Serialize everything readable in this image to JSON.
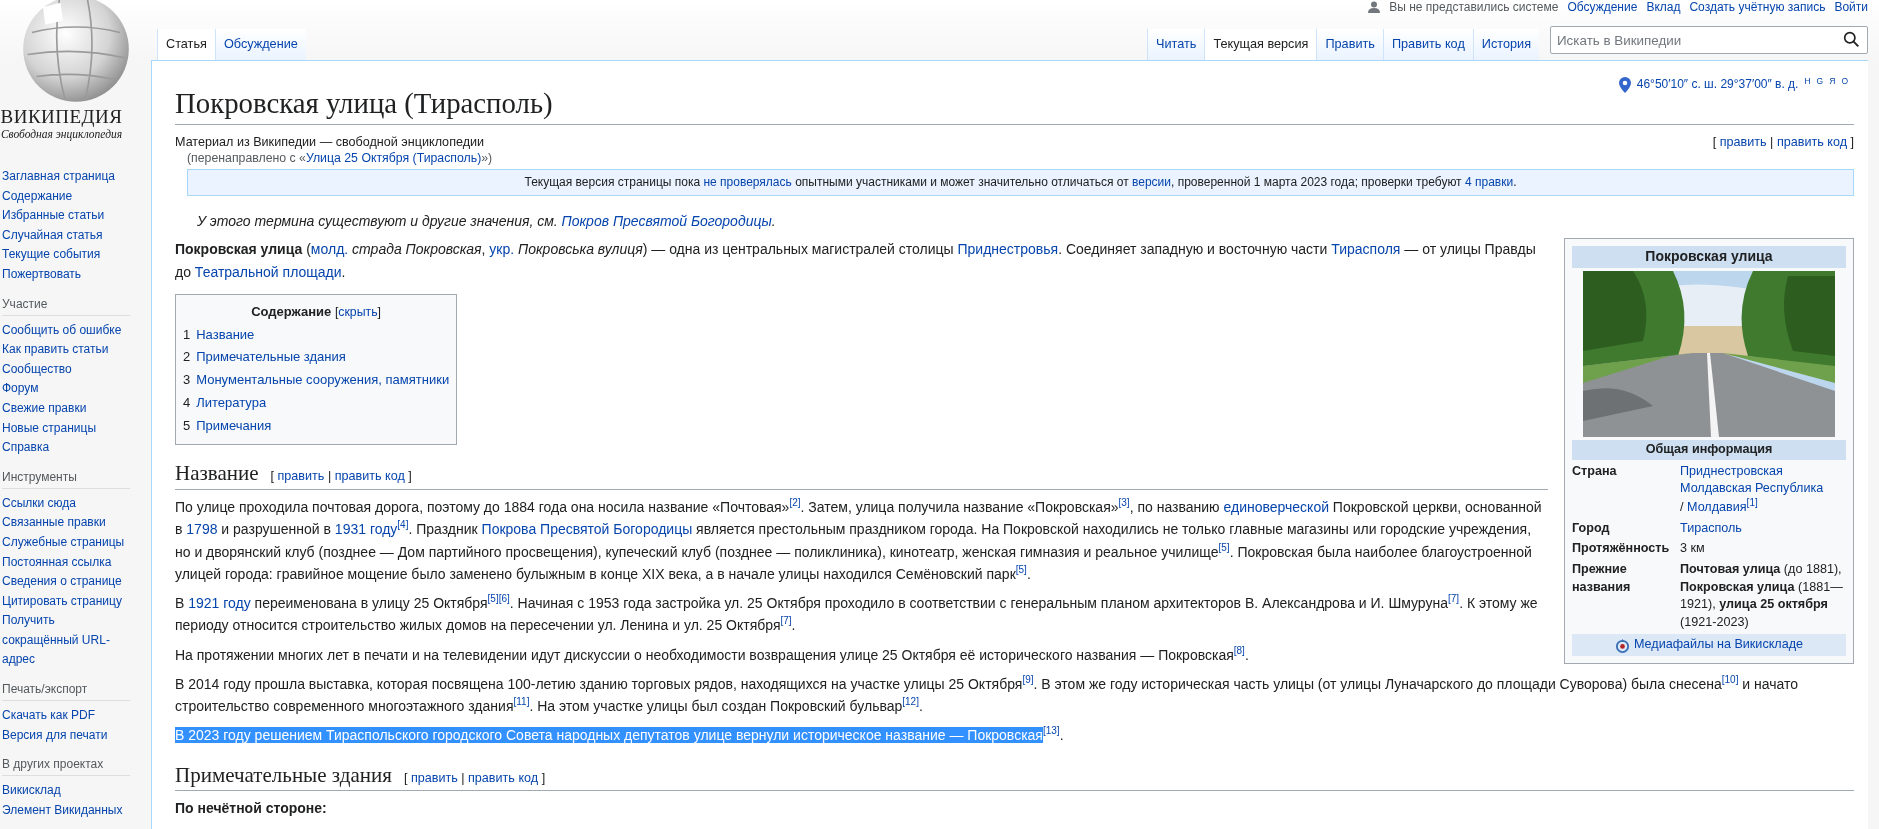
{
  "personal_tools": {
    "status": "Вы не представились системе",
    "links": [
      "Обсуждение",
      "Вклад",
      "Создать учётную запись",
      "Войти"
    ]
  },
  "logo": {
    "wordmark": "ВИКИПЕДИЯ",
    "tagline": "Свободная энциклопедия"
  },
  "sidebar": [
    {
      "items": [
        "Заглавная страница",
        "Содержание",
        "Избранные статьи",
        "Случайная статья",
        "Текущие события",
        "Пожертвовать"
      ]
    },
    {
      "heading": "Участие",
      "items": [
        "Сообщить об ошибке",
        "Как править статьи",
        "Сообщество",
        "Форум",
        "Свежие правки",
        "Новые страницы",
        "Справка"
      ]
    },
    {
      "heading": "Инструменты",
      "items": [
        "Ссылки сюда",
        "Связанные правки",
        "Служебные страницы",
        "Постоянная ссылка",
        "Сведения о странице",
        "Цитировать страницу",
        "Получить сокращённый URL-адрес"
      ]
    },
    {
      "heading": "Печать/экспорт",
      "items": [
        "Скачать как PDF",
        "Версия для печати"
      ]
    },
    {
      "heading": "В других проектах",
      "items": [
        "Викисклад",
        "Элемент Викиданных"
      ]
    }
  ],
  "namespaces": [
    {
      "label": "Статья",
      "selected": true
    },
    {
      "label": "Обсуждение",
      "selected": false
    }
  ],
  "views": [
    {
      "label": "Читать",
      "selected": false
    },
    {
      "label": "Текущая версия",
      "selected": true
    },
    {
      "label": "Править",
      "selected": false
    },
    {
      "label": "Править код",
      "selected": false
    },
    {
      "label": "История",
      "selected": false
    }
  ],
  "search": {
    "placeholder": "Искать в Википедии"
  },
  "article": {
    "title": "Покровская улица (Тирасполь)",
    "coordinates": {
      "text": "46°50′10″ с. ш. 29°37′00″ в. д.",
      "map_links": [
        "H",
        "G",
        "Я",
        "O"
      ]
    },
    "site_sub": "Материал из Википедии — свободной энциклопедии",
    "redirect": [
      {
        "kind": "plain",
        "text": "(перенаправлено с «"
      },
      {
        "kind": "link",
        "text": "Улица 25 Октября (Тирасполь)"
      },
      {
        "kind": "plain",
        "text": "»)"
      }
    ],
    "lead_edit": [
      {
        "kind": "plain",
        "text": "[ "
      },
      {
        "kind": "link",
        "text": "править"
      },
      {
        "kind": "plain",
        "text": " | "
      },
      {
        "kind": "link",
        "text": "править код"
      },
      {
        "kind": "plain",
        "text": " ]"
      }
    ],
    "notice": [
      {
        "kind": "plain",
        "text": "Текущая версия страницы пока "
      },
      {
        "kind": "link",
        "text": "не проверялась"
      },
      {
        "kind": "plain",
        "text": " опытными участниками и может значительно отличаться от "
      },
      {
        "kind": "link",
        "text": "версии"
      },
      {
        "kind": "plain",
        "text": ", проверенной 1 марта 2023 года; проверки требуют "
      },
      {
        "kind": "link",
        "text": "4 правки"
      },
      {
        "kind": "plain",
        "text": "."
      }
    ],
    "hatnote": [
      {
        "kind": "plain",
        "text": "У этого термина существуют и другие значения, см. "
      },
      {
        "kind": "link",
        "text": "Покров Пресвятой Богородицы"
      },
      {
        "kind": "plain",
        "text": "."
      }
    ],
    "intro": [
      {
        "kind": "bold",
        "text": "Покровская улица"
      },
      {
        "kind": "plain",
        "text": " ("
      },
      {
        "kind": "link",
        "text": "молд."
      },
      {
        "kind": "italic",
        "text": " страда Покровская"
      },
      {
        "kind": "plain",
        "text": ", "
      },
      {
        "kind": "link",
        "text": "укр."
      },
      {
        "kind": "italic",
        "text": " Покровська вулиця"
      },
      {
        "kind": "plain",
        "text": ") — одна из центральных магистралей столицы "
      },
      {
        "kind": "link",
        "text": "Приднестровья"
      },
      {
        "kind": "plain",
        "text": ". Соединяет западную и восточную части "
      },
      {
        "kind": "link",
        "text": "Тирасполя"
      },
      {
        "kind": "plain",
        "text": " — от улицы Правды до "
      },
      {
        "kind": "link",
        "text": "Театральной площади"
      },
      {
        "kind": "plain",
        "text": "."
      }
    ],
    "infobox": {
      "title": "Покровская улица",
      "subheader": "Общая информация",
      "rows": [
        {
          "label": "Страна",
          "value": [
            {
              "kind": "blocklink",
              "text": "Приднестровская Молдавская Республика"
            },
            {
              "kind": "plain",
              "text": " / "
            },
            {
              "kind": "link",
              "text": "Молдавия"
            },
            {
              "kind": "ref",
              "text": "[1]"
            }
          ]
        },
        {
          "label": "Город",
          "value": [
            {
              "kind": "link",
              "text": "Тирасполь"
            }
          ]
        },
        {
          "label": "Протяжённость",
          "value": [
            {
              "kind": "plain",
              "text": "3 км"
            }
          ]
        },
        {
          "label": "Прежние названия",
          "value": [
            {
              "kind": "bold",
              "text": "Почтовая улица"
            },
            {
              "kind": "plain",
              "text": " (до 1881), "
            },
            {
              "kind": "bold",
              "text": "Покровская улица"
            },
            {
              "kind": "plain",
              "text": " (1881—1921), "
            },
            {
              "kind": "bold",
              "text": "улица 25 октября"
            },
            {
              "kind": "plain",
              "text": " (1921-2023)"
            }
          ]
        }
      ],
      "commons": "Медиафайлы на Викискладе"
    },
    "toc": {
      "title": "Содержание",
      "toggle": [
        {
          "kind": "plain",
          "text": "["
        },
        {
          "kind": "link",
          "text": "скрыть"
        },
        {
          "kind": "plain",
          "text": "]"
        }
      ],
      "items": [
        {
          "number": "1",
          "label": "Название"
        },
        {
          "number": "2",
          "label": "Примечательные здания"
        },
        {
          "number": "3",
          "label": "Монументальные сооружения, памятники"
        },
        {
          "number": "4",
          "label": "Литература"
        },
        {
          "number": "5",
          "label": "Примечания"
        }
      ]
    },
    "sections": [
      {
        "heading": "Название",
        "edit": [
          {
            "kind": "plain",
            "text": "[ "
          },
          {
            "kind": "link",
            "text": "править"
          },
          {
            "kind": "plain",
            "text": " | "
          },
          {
            "kind": "link",
            "text": "править код"
          },
          {
            "kind": "plain",
            "text": " ]"
          }
        ],
        "paragraphs": [
          {
            "segments": [
              {
                "kind": "plain",
                "text": "По улице проходила почтовая дорога, поэтому до 1884 года она носила название «Почтовая»"
              },
              {
                "kind": "ref",
                "text": "[2]"
              },
              {
                "kind": "plain",
                "text": ". Затем, улица получила название «Покровская»"
              },
              {
                "kind": "ref",
                "text": "[3]"
              },
              {
                "kind": "plain",
                "text": ", по названию "
              },
              {
                "kind": "link",
                "text": "единоверческой"
              },
              {
                "kind": "plain",
                "text": " Покровской церкви, основанной в "
              },
              {
                "kind": "link",
                "text": "1798"
              },
              {
                "kind": "plain",
                "text": " и разрушенной в "
              },
              {
                "kind": "link",
                "text": "1931 году"
              },
              {
                "kind": "ref",
                "text": "[4]"
              },
              {
                "kind": "plain",
                "text": ". Праздник "
              },
              {
                "kind": "link",
                "text": "Покрова Пресвятой Богородицы"
              },
              {
                "kind": "plain",
                "text": " является престольным праздником города. На Покровской находились не только главные магазины или городские учреждения, но и дворянский клуб (позднее — Дом партийного просвещения), купеческий клуб (позднее — поликлиника), кинотеатр, женская гимназия и реальное училище"
              },
              {
                "kind": "ref",
                "text": "[5]"
              },
              {
                "kind": "plain",
                "text": ". Покровская была наиболее благоустроенной улицей города: гравийное мощение было заменено булыжным в конце XIX века, а в начале улицы находился Семёновский парк"
              },
              {
                "kind": "ref",
                "text": "[5]"
              },
              {
                "kind": "plain",
                "text": "."
              }
            ]
          },
          {
            "segments": [
              {
                "kind": "plain",
                "text": "В "
              },
              {
                "kind": "link",
                "text": "1921 году"
              },
              {
                "kind": "plain",
                "text": " переименована в улицу 25 Октября"
              },
              {
                "kind": "ref",
                "text": "[5]"
              },
              {
                "kind": "ref",
                "text": "[6]"
              },
              {
                "kind": "plain",
                "text": ". Начиная с 1953 года застройка ул. 25 Октября проходило в соответствии с генеральным планом архитекторов В. Александрова и И. Шмуруна"
              },
              {
                "kind": "ref",
                "text": "[7]"
              },
              {
                "kind": "plain",
                "text": ". К этому же периоду относится строительство жилых домов на пересечении ул. Ленина и ул. 25 Октября"
              },
              {
                "kind": "ref",
                "text": "[7]"
              },
              {
                "kind": "plain",
                "text": "."
              }
            ]
          },
          {
            "segments": [
              {
                "kind": "plain",
                "text": "На протяжении многих лет в печати и на телевидении идут дискуссии о необходимости возвращения улице 25 Октября её исторического названия — Покровская"
              },
              {
                "kind": "ref",
                "text": "[8]"
              },
              {
                "kind": "plain",
                "text": "."
              }
            ]
          },
          {
            "segments": [
              {
                "kind": "plain",
                "text": "В 2014 году прошла выставка, которая посвящена 100-летию зданию торговых рядов, находящихся на участке улицы 25 Октября"
              },
              {
                "kind": "ref",
                "text": "[9]"
              },
              {
                "kind": "plain",
                "text": ". В этом же году историческая часть улицы (от улицы Луначарского до площади Суворова) была снесена"
              },
              {
                "kind": "ref",
                "text": "[10]"
              },
              {
                "kind": "plain",
                "text": " и начато строительство современного многоэтажного здания"
              },
              {
                "kind": "ref",
                "text": "[11]"
              },
              {
                "kind": "plain",
                "text": ". На этом участке улицы был создан Покровский бульвар"
              },
              {
                "kind": "ref",
                "text": "[12]"
              },
              {
                "kind": "plain",
                "text": "."
              }
            ]
          },
          {
            "segments": [
              {
                "kind": "selection",
                "text": "В 2023 году решением Тираспольского городского Совета народных депутатов улице вернули историческое название — Покровская"
              },
              {
                "kind": "ref",
                "text": "[13]"
              },
              {
                "kind": "plain",
                "text": "."
              }
            ]
          }
        ]
      },
      {
        "heading": "Примечательные здания",
        "edit": [
          {
            "kind": "plain",
            "text": "[ "
          },
          {
            "kind": "link",
            "text": "править"
          },
          {
            "kind": "plain",
            "text": " | "
          },
          {
            "kind": "link",
            "text": "править код"
          },
          {
            "kind": "plain",
            "text": " ]"
          }
        ],
        "paragraphs": [
          {
            "segments": [
              {
                "kind": "bold",
                "text": "По нечётной стороне:"
              }
            ]
          }
        ]
      }
    ]
  }
}
